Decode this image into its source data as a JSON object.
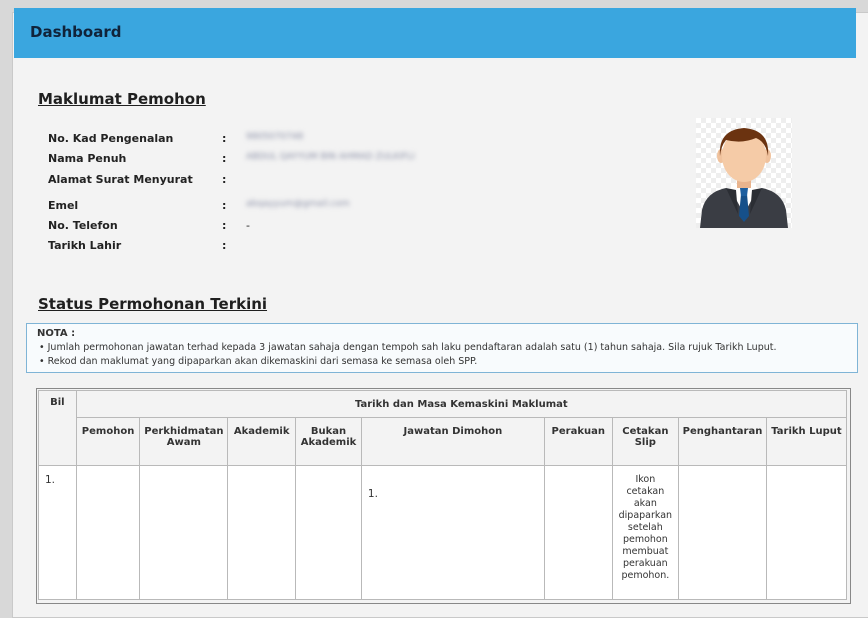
{
  "dashboard": {
    "title": "Dashboard"
  },
  "maklumat": {
    "title": "Maklumat Pemohon",
    "rows": [
      {
        "label": "No. Kad Pengenalan",
        "value": "9805070748"
      },
      {
        "label": "Nama Penuh",
        "value": "ABDUL QAYYUM BIN AHMAD ZULKIFLI"
      },
      {
        "label": "Alamat Surat Menyurat",
        "value": ""
      },
      {
        "label": "Emel",
        "value": "abqayyum@gmail.com"
      },
      {
        "label": "No. Telefon",
        "value": "-"
      },
      {
        "label": "Tarikh Lahir",
        "value": ""
      }
    ],
    "colon": ":"
  },
  "status": {
    "title": "Status Permohonan Terkini",
    "nota_title": "NOTA :",
    "nota_items": [
      "• Jumlah permohonan jawatan terhad kepada 3 jawatan sahaja dengan tempoh sah laku pendaftaran adalah satu (1) tahun sahaja. Sila rujuk Tarikh Luput.",
      "• Rekod dan maklumat yang dipaparkan akan dikemaskini dari semasa ke semasa oleh SPP."
    ]
  },
  "table": {
    "bil": "Bil",
    "group_header": "Tarikh dan Masa Kemaskini Maklumat",
    "columns": [
      "Pemohon",
      "Perkhidmatan Awam",
      "Akademik",
      "Bukan Akademik",
      "Jawatan Dimohon",
      "Perakuan",
      "Cetakan Slip",
      "Penghantaran",
      "Tarikh Luput"
    ],
    "rows": [
      {
        "bil": "1.",
        "pemohon": "",
        "perkhidmatan": "",
        "akademik": "",
        "bukan_akademik": "",
        "jawatan": "1.",
        "perakuan": "",
        "cetakan": "Ikon cetakan akan dipaparkan setelah pemohon membuat perakuan pemohon.",
        "penghantaran": "",
        "luput": ""
      }
    ]
  },
  "colors": {
    "header_bar": "#3aa6df",
    "note_text_red": "#c0392b",
    "nota_border": "#7fb4d6"
  },
  "icons": {
    "avatar": "businessman-avatar-icon"
  }
}
